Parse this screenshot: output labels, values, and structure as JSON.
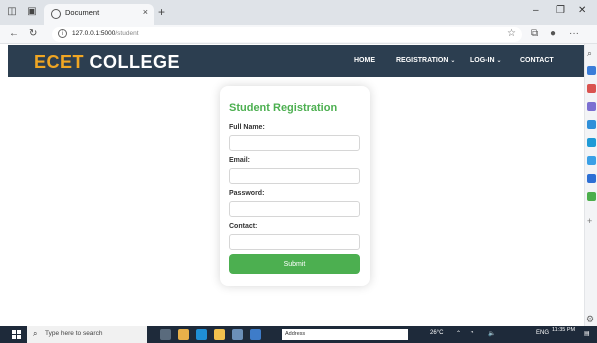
{
  "browser": {
    "tab_title": "Document",
    "tab_close": "×",
    "new_tab": "+",
    "url_host": "127.0.0.1:5000",
    "url_path": "/student",
    "minimize": "–",
    "restore": "❐",
    "close": "✕",
    "more": "···"
  },
  "navbar": {
    "brand_accent": "ECET",
    "brand_rest": " COLLEGE",
    "items": [
      {
        "label": "HOME"
      },
      {
        "label": "REGISTRATION",
        "caret": "⌄"
      },
      {
        "label": "LOG-IN",
        "caret": "⌄"
      },
      {
        "label": "CONTACT"
      }
    ]
  },
  "form": {
    "title": "Student Registration",
    "fields": [
      {
        "label": "Full Name:",
        "value": "",
        "placeholder": ""
      },
      {
        "label": "Email:",
        "value": "",
        "placeholder": ""
      },
      {
        "label": "Password:",
        "value": "",
        "placeholder": ""
      },
      {
        "label": "Contact:",
        "value": "",
        "placeholder": ""
      }
    ],
    "submit_label": "Submit"
  },
  "taskbar": {
    "search_placeholder": "Type here to search",
    "address_label": "Address",
    "weather": "26°C",
    "language": "ENG",
    "time": "11:35 PM"
  },
  "colors": {
    "navbar_bg": "#2c3e50",
    "brand_accent": "#f0a623",
    "form_accent": "#4caf50",
    "taskbar_bg": "#1e2a3a"
  },
  "icons": [
    "tab-actions-icon",
    "tab-list-icon",
    "page-icon",
    "back-arrow-icon",
    "refresh-icon",
    "site-info-icon",
    "favorite-star-icon",
    "collections-icon",
    "profile-icon",
    "more-icon",
    "search-icon",
    "settings-gear-icon",
    "windows-start-icon"
  ]
}
